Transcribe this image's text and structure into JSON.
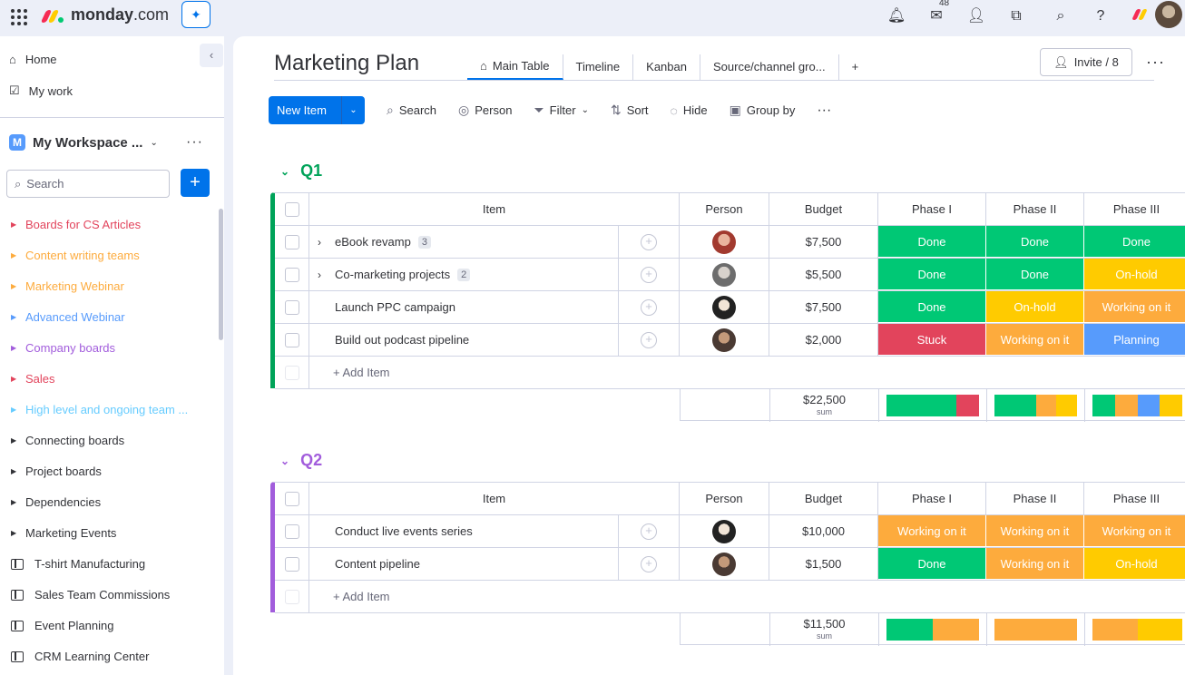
{
  "app": {
    "brand": "monday",
    "brand_suffix": ".com",
    "notifications_count": "48"
  },
  "sidebar": {
    "home": "Home",
    "my_work": "My work",
    "workspace": "My Workspace ...",
    "workspace_initial": "M",
    "search_placeholder": "Search",
    "items": [
      {
        "label": "Boards for CS Articles",
        "color": "#e2445c"
      },
      {
        "label": "Content writing teams",
        "color": "#fdab3d"
      },
      {
        "label": "Marketing Webinar",
        "color": "#fdab3d"
      },
      {
        "label": "Advanced Webinar",
        "color": "#579bfc"
      },
      {
        "label": "Company boards",
        "color": "#a25ddc"
      },
      {
        "label": "Sales",
        "color": "#e2445c"
      },
      {
        "label": "High level and ongoing team ...",
        "color": "#66ccff"
      },
      {
        "label": "Connecting boards",
        "color": "#323338"
      },
      {
        "label": "Project boards",
        "color": "#323338"
      },
      {
        "label": "Dependencies",
        "color": "#323338"
      },
      {
        "label": "Marketing Events",
        "color": "#323338"
      },
      {
        "label": "T-shirt Manufacturing",
        "color": "#323338"
      },
      {
        "label": "Sales Team Commissions",
        "color": "#323338"
      },
      {
        "label": "Event Planning",
        "color": "#323338"
      },
      {
        "label": "CRM Learning Center",
        "color": "#323338"
      }
    ]
  },
  "board": {
    "title": "Marketing Plan",
    "tabs": [
      "Main Table",
      "Timeline",
      "Kanban",
      "Source/channel gro...",
      "+"
    ],
    "invite": "Invite / 8",
    "toolbar": {
      "new_item": "New Item",
      "search": "Search",
      "person": "Person",
      "filter": "Filter",
      "sort": "Sort",
      "hide": "Hide",
      "group_by": "Group by"
    },
    "columns": [
      "Item",
      "Person",
      "Budget",
      "Phase I",
      "Phase II",
      "Phase III"
    ],
    "add_item": "+ Add Item",
    "sum_label": "sum"
  },
  "status_colors": {
    "Done": "#00c875",
    "On-hold": "#ffcb00",
    "Working on it": "#fdab3d",
    "Stuck": "#e2445c",
    "Planning": "#579bfc"
  },
  "groups": [
    {
      "name": "Q1",
      "color": "#00a359",
      "rows": [
        {
          "item": "eBook revamp",
          "subitems": "3",
          "budget": "$7,500",
          "phases": [
            "Done",
            "Done",
            "Done"
          ]
        },
        {
          "item": "Co-marketing projects",
          "subitems": "2",
          "budget": "$5,500",
          "phases": [
            "Done",
            "Done",
            "On-hold"
          ]
        },
        {
          "item": "Launch PPC campaign",
          "subitems": "",
          "budget": "$7,500",
          "phases": [
            "Done",
            "On-hold",
            "Working on it"
          ]
        },
        {
          "item": "Build out podcast pipeline",
          "subitems": "",
          "budget": "$2,000",
          "phases": [
            "Stuck",
            "Working on it",
            "Planning"
          ]
        }
      ],
      "sum": "$22,500",
      "phase_bars": [
        [
          {
            "color": "#00c875",
            "share": 0.75
          },
          {
            "color": "#e2445c",
            "share": 0.25
          }
        ],
        [
          {
            "color": "#00c875",
            "share": 0.5
          },
          {
            "color": "#fdab3d",
            "share": 0.25
          },
          {
            "color": "#ffcb00",
            "share": 0.25
          }
        ],
        [
          {
            "color": "#00c875",
            "share": 0.25
          },
          {
            "color": "#fdab3d",
            "share": 0.25
          },
          {
            "color": "#579bfc",
            "share": 0.25
          },
          {
            "color": "#ffcb00",
            "share": 0.25
          }
        ]
      ]
    },
    {
      "name": "Q2",
      "color": "#a25ddc",
      "rows": [
        {
          "item": "Conduct live events series",
          "subitems": "",
          "budget": "$10,000",
          "phases": [
            "Working on it",
            "Working on it",
            "Working on it"
          ]
        },
        {
          "item": "Content pipeline",
          "subitems": "",
          "budget": "$1,500",
          "phases": [
            "Done",
            "Working on it",
            "On-hold"
          ]
        }
      ],
      "sum": "$11,500",
      "phase_bars": [
        [
          {
            "color": "#00c875",
            "share": 0.5
          },
          {
            "color": "#fdab3d",
            "share": 0.5
          }
        ],
        [
          {
            "color": "#fdab3d",
            "share": 1
          }
        ],
        [
          {
            "color": "#fdab3d",
            "share": 0.5
          },
          {
            "color": "#ffcb00",
            "share": 0.5
          }
        ]
      ]
    }
  ]
}
